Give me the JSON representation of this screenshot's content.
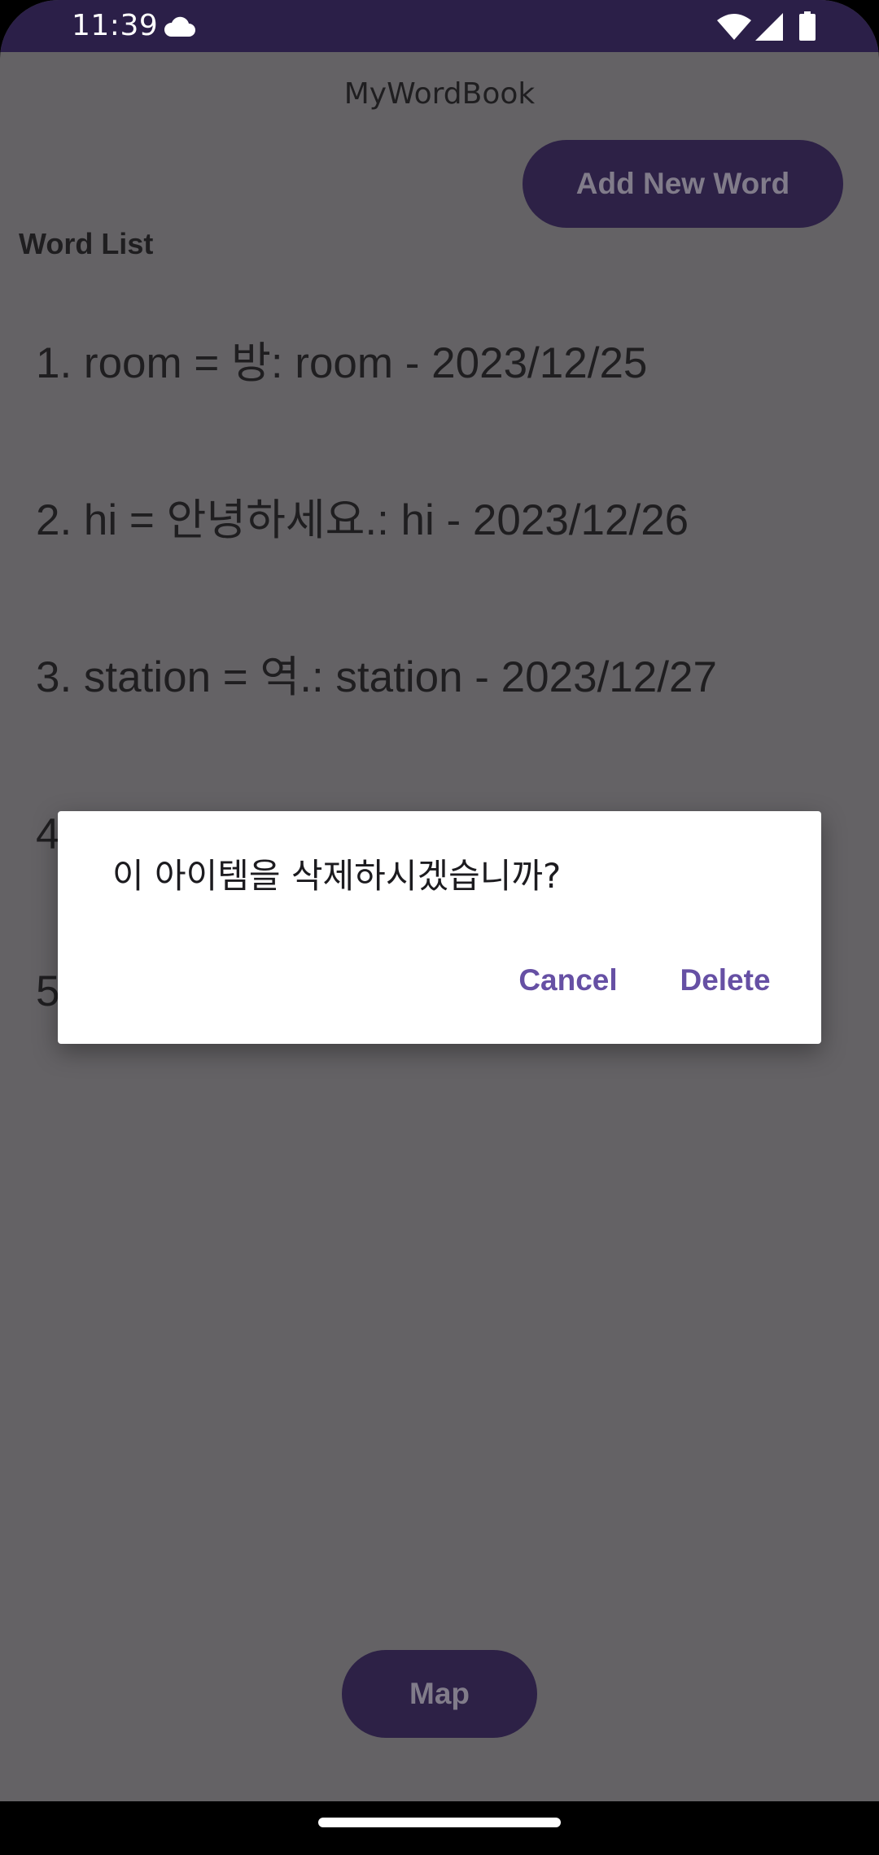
{
  "status_bar": {
    "time": "11:39",
    "icons": [
      "cloud-icon",
      "wifi-icon",
      "signal-icon",
      "battery-icon"
    ]
  },
  "app": {
    "title": "MyWordBook",
    "add_button_label": "Add New Word",
    "section_title": "Word List",
    "words": [
      "1. room = 방: room - 2023/12/25",
      "2. hi = 안녕하세요.: hi - 2023/12/26",
      "3. station = 역.: station - 2023/12/27",
      "4",
      "5"
    ],
    "map_button_label": "Map"
  },
  "dialog": {
    "message": "이 아이템을 삭제하시겠습니까?",
    "cancel_label": "Cancel",
    "delete_label": "Delete"
  },
  "colors": {
    "status_bar_bg": "#2b1f48",
    "scrim_bg": "#646265",
    "button_bg": "#2d2146",
    "dialog_accent": "#6650a4"
  }
}
